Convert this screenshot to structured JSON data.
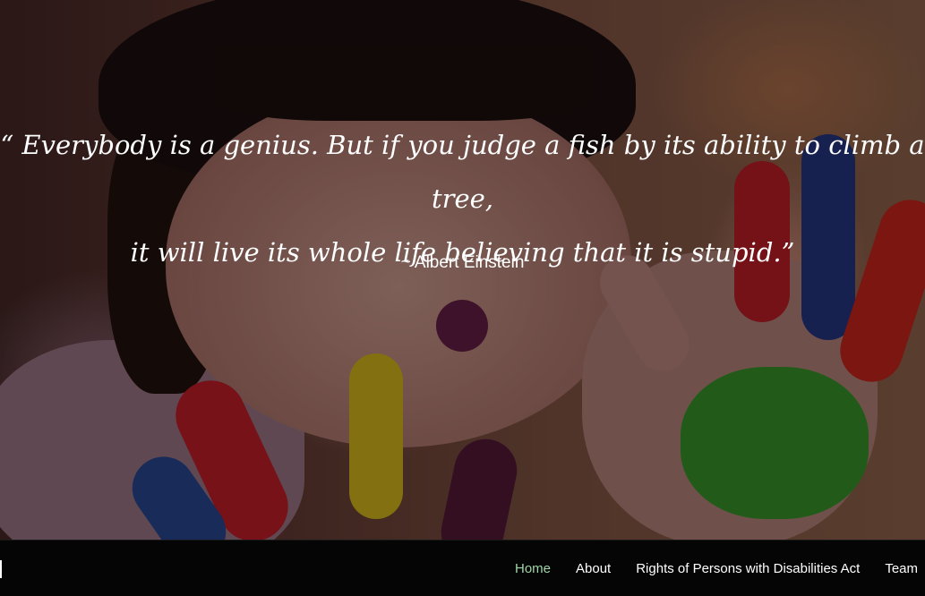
{
  "hero": {
    "quote_line_1": "“ Everybody is a genius. But if you judge a fish by its ability to climb a tree,",
    "quote_line_2": "it will live its whole life believing that it is stupid.”",
    "author": "~ Albert Einstein"
  },
  "navbar": {
    "items": [
      {
        "label": "Home",
        "active": true
      },
      {
        "label": "About",
        "active": false
      },
      {
        "label": "Rights of Persons with Disabilities Act",
        "active": false
      },
      {
        "label": "Team",
        "active": false
      }
    ]
  },
  "colors": {
    "nav_background": "#050505",
    "nav_text": "#ffffff",
    "nav_active": "#9fd4a8",
    "quote_text": "#ffffff"
  }
}
